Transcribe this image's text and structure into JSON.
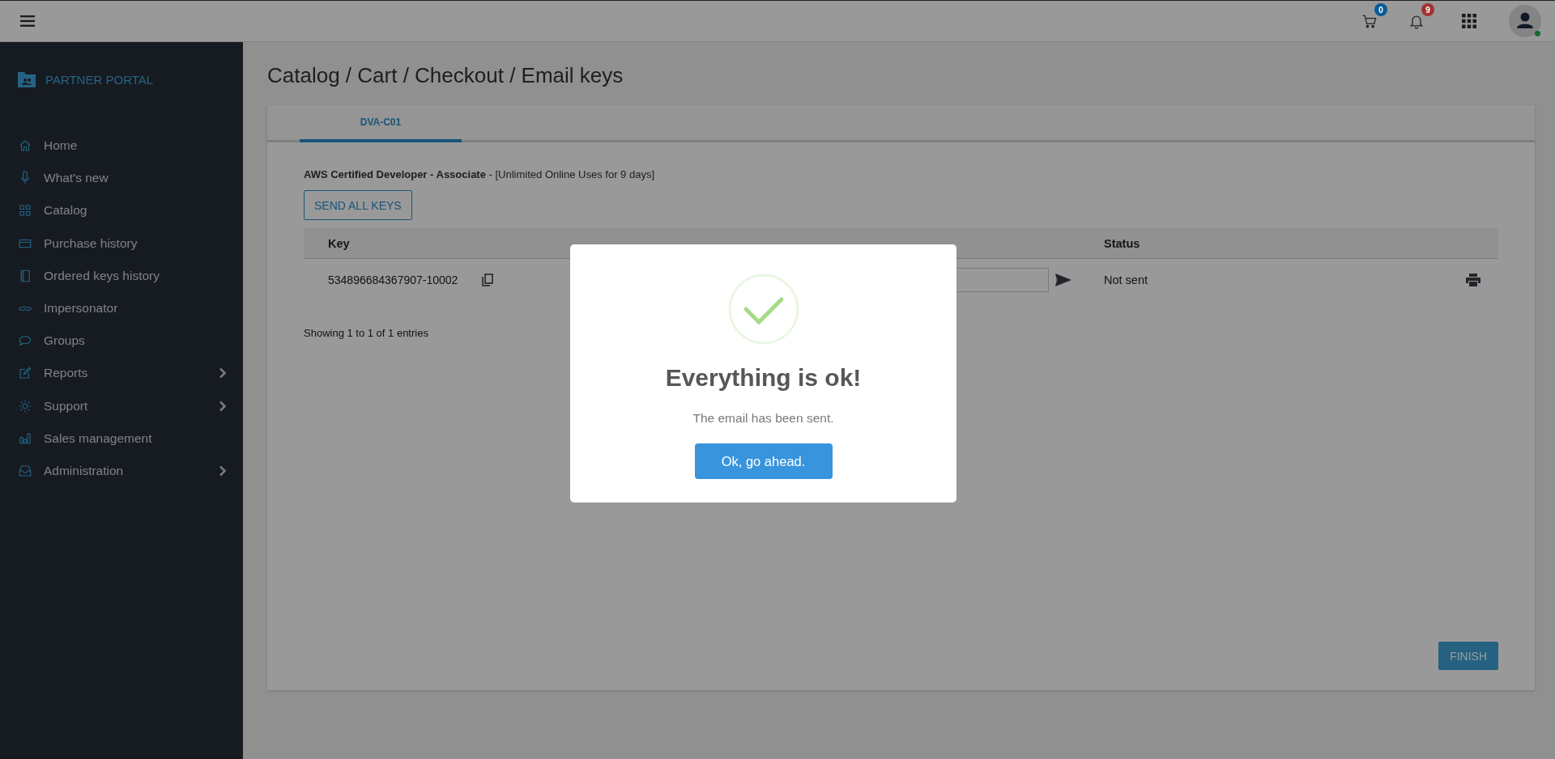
{
  "topbar": {
    "cart_badge": {
      "count": "0",
      "color": "#0a5a96"
    },
    "notifications_badge": {
      "count": "9",
      "color": "#a33232"
    },
    "user": {
      "online": true
    }
  },
  "sidebar": {
    "brand": "PARTNER PORTAL",
    "items": [
      {
        "label": "Home",
        "expandable": false
      },
      {
        "label": "What's new",
        "expandable": false
      },
      {
        "label": "Catalog",
        "expandable": false
      },
      {
        "label": "Purchase history",
        "expandable": false
      },
      {
        "label": "Ordered keys history",
        "expandable": false
      },
      {
        "label": "Impersonator",
        "expandable": false
      },
      {
        "label": "Groups",
        "expandable": false
      },
      {
        "label": "Reports",
        "expandable": true
      },
      {
        "label": "Support",
        "expandable": true
      },
      {
        "label": "Sales management",
        "expandable": false
      },
      {
        "label": "Administration",
        "expandable": true
      }
    ]
  },
  "breadcrumb": "Catalog / Cart / Checkout / Email keys",
  "tabs": [
    {
      "label": "DVA-C01",
      "selected": true
    }
  ],
  "product": "**AWS Certified Developer - Associate** - [Unlimited Online Uses for 9 days]",
  "send_all_button": "SEND ALL KEYS",
  "table": {
    "columns": [
      "Key",
      "Status"
    ],
    "rows": [
      {
        "key": "534896684367907-10002",
        "status": "Not sent"
      }
    ]
  },
  "entries_info": "Showing 1 to 1 of 1 entries",
  "finish_button": "FINISH",
  "dialog": {
    "title": "Everything is ok!",
    "message": "The email has been sent.",
    "button": "Ok, go ahead."
  }
}
